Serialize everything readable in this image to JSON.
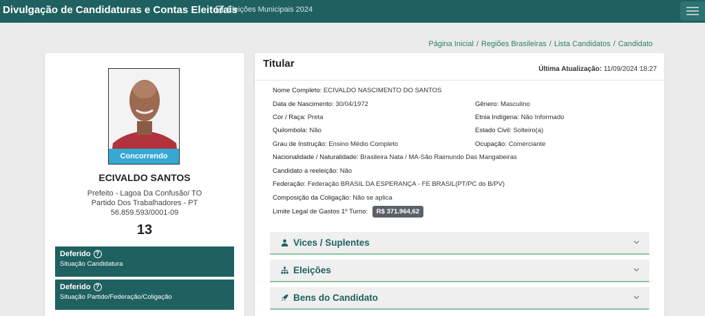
{
  "header": {
    "title": "Divulgação de Candidaturas e Contas Eleitorais",
    "election_link": "Eleições Municipais 2024"
  },
  "breadcrumb": [
    "Página Inicial",
    "Regiões Brasileiras",
    "Lista Candidatos",
    "Candidato"
  ],
  "candidate": {
    "status_pill": "Concorrendo",
    "name": "ECIVALDO SANTOS",
    "office": "Prefeito - Lagoa Da Confusão/ TO",
    "party": "Partido Dos Trabalhadores - PT",
    "cnpj": "56.859.593/0001-09",
    "number": "13",
    "situations": [
      {
        "title": "Deferido",
        "subtitle": "Situação Candidatura"
      },
      {
        "title": "Deferido",
        "subtitle": "Situação Partido/Federação/Coligação"
      }
    ]
  },
  "detail": {
    "title": "Titular",
    "last_update_label": "Última Atualização:",
    "last_update_value": "11/09/2024 18:27",
    "fields": {
      "nome_completo": {
        "label": "Nome Completo:",
        "value": "ECIVALDO NASCIMENTO DO SANTOS"
      },
      "data_nascimento": {
        "label": "Data de Nascimento:",
        "value": "30/04/1972"
      },
      "genero": {
        "label": "Gênero:",
        "value": "Masculino"
      },
      "cor_raca": {
        "label": "Cor / Raça:",
        "value": "Preta"
      },
      "etnia": {
        "label": "Etnia Indígena:",
        "value": "Não Informado"
      },
      "quilombola": {
        "label": "Quilombola:",
        "value": "Não"
      },
      "estado_civil": {
        "label": "Estado Civil:",
        "value": "Solteiro(a)"
      },
      "grau_instrucao": {
        "label": "Grau de Instrução:",
        "value": "Ensino Médio Completo"
      },
      "ocupacao": {
        "label": "Ocupação:",
        "value": "Comerciante"
      },
      "nacionalidade": {
        "label": "Nacionalidade / Naturalidade:",
        "value": "Brasileira Nata / MA-São Raimundo Das Mangabeiras"
      },
      "reeleicao": {
        "label": "Candidato a reeleição:",
        "value": "Não"
      },
      "federacao": {
        "label": "Federação:",
        "value": "Federação BRASIL DA ESPERANÇA - FE BRASIL(PT/PC do B/PV)"
      },
      "coligacao": {
        "label": "Composição da Coligação:",
        "value": "Não se aplica"
      },
      "limite_gastos": {
        "label": "Limite Legal de Gastos 1º Turno:",
        "value": "R$ 371.964,62"
      }
    },
    "accordions": [
      {
        "label": "Vices / Suplentes",
        "icon": "user-icon"
      },
      {
        "label": "Eleições",
        "icon": "sitemap-icon"
      },
      {
        "label": "Bens do Candidato",
        "icon": "rocket-icon"
      }
    ]
  }
}
